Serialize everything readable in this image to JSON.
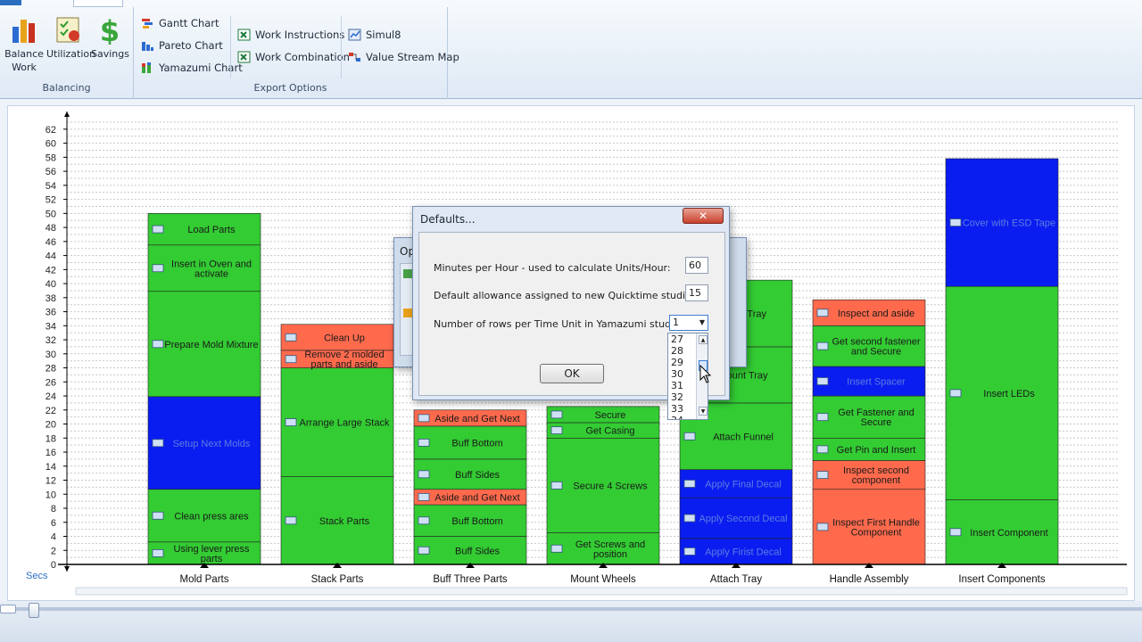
{
  "ribbon": {
    "balancing": {
      "group_label": "Balancing",
      "buttons": [
        {
          "label_1": "Balance",
          "label_2": "Work",
          "icon": "bar-chart-icon"
        },
        {
          "label_1": "Utilization",
          "icon": "checklist-icon"
        },
        {
          "label_1": "Savings",
          "icon": "dollar-icon"
        }
      ]
    },
    "export": {
      "group_label": "Export Options",
      "buttons": [
        {
          "label": "Gantt Chart",
          "icon": "gantt-icon"
        },
        {
          "label": "Pareto Chart",
          "icon": "pareto-icon"
        },
        {
          "label": "Yamazumi Chart",
          "icon": "yamazumi-icon"
        },
        {
          "label": "Work Instructions",
          "icon": "excel-icon"
        },
        {
          "label": "Work Combination",
          "icon": "excel-icon"
        },
        {
          "label": "Simul8",
          "icon": "simul8-icon"
        },
        {
          "label": "Value Stream Map",
          "icon": "vsm-icon"
        }
      ]
    }
  },
  "chart_data": {
    "type": "bar",
    "stacked": true,
    "ylabel": "Secs",
    "ylim": [
      0,
      63
    ],
    "yticks": [
      0,
      2,
      4,
      6,
      8,
      10,
      12,
      14,
      16,
      18,
      20,
      22,
      24,
      26,
      28,
      30,
      32,
      34,
      36,
      38,
      40,
      42,
      44,
      46,
      48,
      50,
      52,
      54,
      56,
      58,
      60,
      62
    ],
    "colors": {
      "green": "#33cc33",
      "red": "#ff6a4d",
      "blue": "#0a1df0"
    },
    "categories": [
      "Mold Parts",
      "Stack Parts",
      "Buff Three Parts",
      "Mount Wheels",
      "Attach Tray",
      "Handle Assembly",
      "Insert Components"
    ],
    "stacks": [
      [
        {
          "label": "Using lever press parts",
          "value": 3.2,
          "color": "green"
        },
        {
          "label": "Clean press ares",
          "value": 7.5,
          "color": "green"
        },
        {
          "label": "Setup Next Molds",
          "value": 13.2,
          "color": "blue"
        },
        {
          "label": "Prepare Mold Mixture",
          "value": 15.0,
          "color": "green"
        },
        {
          "label": "Insert in Oven and activate",
          "value": 6.6,
          "color": "green"
        },
        {
          "label": "Load Parts",
          "value": 4.5,
          "color": "green"
        }
      ],
      [
        {
          "label": "Stack Parts",
          "value": 12.5,
          "color": "green"
        },
        {
          "label": "Arrange Large Stack",
          "value": 15.5,
          "color": "green"
        },
        {
          "label": "Remove 2 molded parts and aside",
          "value": 2.5,
          "color": "red"
        },
        {
          "label": "Clean Up",
          "value": 3.7,
          "color": "red"
        }
      ],
      [
        {
          "label": "Buff Sides",
          "value": 4.0,
          "color": "green"
        },
        {
          "label": "Buff Bottom",
          "value": 4.5,
          "color": "green"
        },
        {
          "label": "Aside and Get Next",
          "value": 2.2,
          "color": "red"
        },
        {
          "label": "Buff Sides",
          "value": 4.3,
          "color": "green"
        },
        {
          "label": "Buff Bottom",
          "value": 4.7,
          "color": "green"
        },
        {
          "label": "Aside and Get Next",
          "value": 2.3,
          "color": "red"
        }
      ],
      [
        {
          "label": "Get Screws and position",
          "value": 4.5,
          "color": "green"
        },
        {
          "label": "Secure 4 Screws",
          "value": 13.5,
          "color": "green"
        },
        {
          "label": "Get Casing",
          "value": 2.2,
          "color": "green"
        },
        {
          "label": "Secure",
          "value": 2.3,
          "color": "green"
        }
      ],
      [
        {
          "label": "Apply Firist Decal",
          "value": 3.7,
          "color": "blue"
        },
        {
          "label": "Apply Second Decal",
          "value": 5.8,
          "color": "blue"
        },
        {
          "label": "Apply Final Decal",
          "value": 4.0,
          "color": "blue"
        },
        {
          "label": "Attach Funnel",
          "value": 9.5,
          "color": "green"
        },
        {
          "label": "Mount Tray",
          "value": 8.0,
          "color": "green"
        },
        {
          "label": "Place Tray",
          "value": 9.5,
          "color": "green"
        }
      ],
      [
        {
          "label": "Inspect First Handle Component",
          "value": 10.7,
          "color": "red"
        },
        {
          "label": "Inspect second component",
          "value": 4.1,
          "color": "red"
        },
        {
          "label": "Get Pin and Insert",
          "value": 3.2,
          "color": "green"
        },
        {
          "label": "Get Fastener and Secure",
          "value": 6.0,
          "color": "green"
        },
        {
          "label": "Insert Spacer",
          "value": 4.2,
          "color": "blue"
        },
        {
          "label": "Get second fastener and Secure",
          "value": 5.8,
          "color": "green"
        },
        {
          "label": "Inspect and aside",
          "value": 3.7,
          "color": "red"
        }
      ],
      [
        {
          "label": "Insert Component",
          "value": 9.2,
          "color": "green"
        },
        {
          "label": "Insert LEDs",
          "value": 30.4,
          "color": "green"
        },
        {
          "label": "Cover with ESD Tape",
          "value": 18.2,
          "color": "blue"
        }
      ]
    ]
  },
  "bg_dialog": {
    "title": "Op"
  },
  "dialog": {
    "title": "Defaults...",
    "fields": [
      {
        "label": "Minutes per Hour - used to calculate Units/Hour:",
        "value": "60"
      },
      {
        "label": "Default allowance assigned to new Quicktime studies:",
        "value": "15"
      }
    ],
    "rows_label": "Number of rows per Time Unit in Yamazumi study:",
    "rows_value": "1",
    "dropdown_options": [
      "27",
      "28",
      "29",
      "30",
      "31",
      "32",
      "33",
      "34"
    ],
    "ok_label": "OK"
  }
}
